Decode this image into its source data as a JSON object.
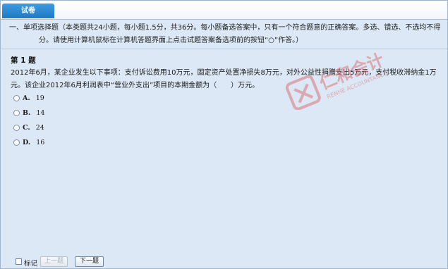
{
  "tab": {
    "label": "试卷"
  },
  "instructions": {
    "line1": "一、单项选择题（本类题共24小题，每小题1.5分，共36分。每小题备选答案中，只有一个符合题意的正确答案。多选、错选、不选均不得",
    "line2": "分。请使用计算机鼠标在计算机答题界面上点击试题答案备选项前的按钮“○”作答。）"
  },
  "question": {
    "number_label": "第 1 题",
    "stem": "2012年6月，某企业发生以下事项：支付诉讼费用10万元，固定资产处置净损失8万元，对外公益性捐赠支出5万元，支付税收滞纳金1万元。该企业2012年6月利润表中“营业外支出”项目的本期金额为（　　）万元。",
    "options": [
      {
        "letter": "A.",
        "value": "19"
      },
      {
        "letter": "B.",
        "value": "14"
      },
      {
        "letter": "C.",
        "value": "24"
      },
      {
        "letter": "D.",
        "value": "16"
      }
    ]
  },
  "footer": {
    "mark_label": "标记",
    "prev_label": "上一题",
    "next_label": "下一题"
  },
  "watermark": {
    "brand": "仁和会计",
    "sub": "RENHE ACCOUNTANCY"
  },
  "colors": {
    "tab_active": "#2b88d3",
    "background": "#dce8f5",
    "watermark": "#d9757a"
  }
}
